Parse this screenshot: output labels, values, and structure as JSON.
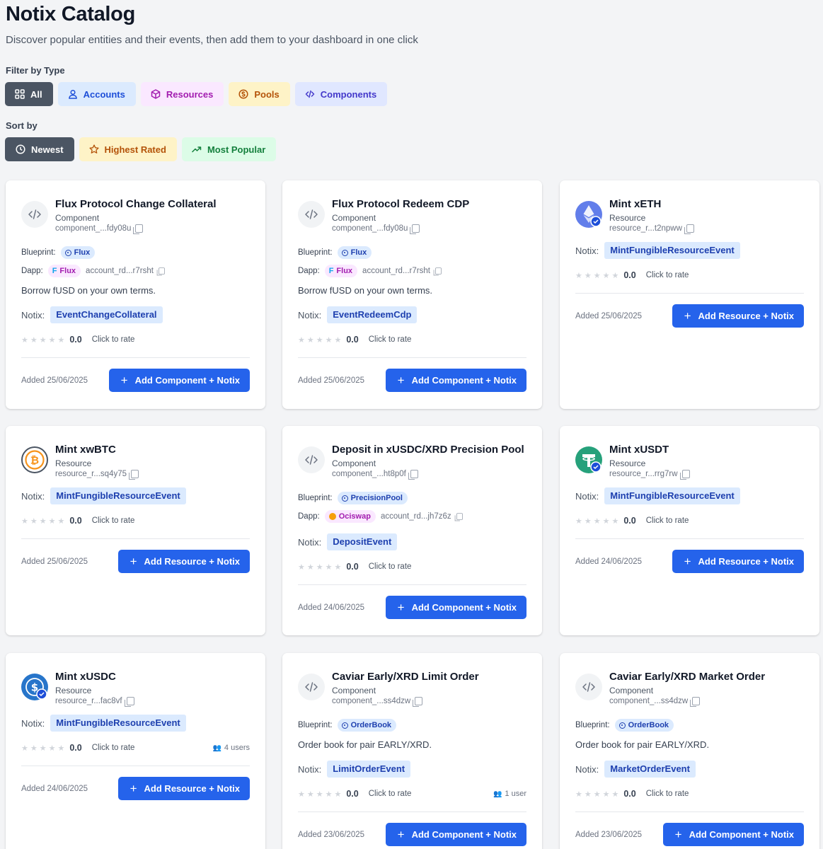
{
  "header": {
    "title": "Notix Catalog",
    "subtitle": "Discover popular entities and their events, then add them to your dashboard in one click"
  },
  "filter": {
    "label": "Filter by Type",
    "options": [
      {
        "label": "All",
        "icon": "grid-icon",
        "selected": true
      },
      {
        "label": "Accounts",
        "icon": "user-icon",
        "selected": false
      },
      {
        "label": "Resources",
        "icon": "box-icon",
        "selected": false
      },
      {
        "label": "Pools",
        "icon": "coin-icon",
        "selected": false
      },
      {
        "label": "Components",
        "icon": "code-icon",
        "selected": false
      }
    ]
  },
  "sort": {
    "label": "Sort by",
    "options": [
      {
        "label": "Newest",
        "icon": "clock-icon",
        "selected": true
      },
      {
        "label": "Highest Rated",
        "icon": "star-icon",
        "selected": false
      },
      {
        "label": "Most Popular",
        "icon": "trending-up-icon",
        "selected": false
      }
    ]
  },
  "common": {
    "blueprint_label": "Blueprint:",
    "dapp_label": "Dapp:",
    "notix_label": "Notix:",
    "click_to_rate": "Click to rate",
    "stars": "★★★★★"
  },
  "cards": [
    {
      "title": "Flux Protocol Change Collateral",
      "type": "Component",
      "address": "component_...fdy08u",
      "icon": "code-icon",
      "blueprint": "Flux",
      "dapp": "Flux",
      "dapp_account": "account_rd...r7rsht",
      "description": "Borrow fUSD on your own terms.",
      "event": "EventChangeCollateral",
      "rating": "0.0",
      "users": "",
      "added": "Added 25/06/2025",
      "button": "Add Component + Notix"
    },
    {
      "title": "Flux Protocol Redeem CDP",
      "type": "Component",
      "address": "component_...fdy08u",
      "icon": "code-icon",
      "blueprint": "Flux",
      "dapp": "Flux",
      "dapp_account": "account_rd...r7rsht",
      "description": "Borrow fUSD on your own terms.",
      "event": "EventRedeemCdp",
      "rating": "0.0",
      "users": "",
      "added": "Added 25/06/2025",
      "button": "Add Component + Notix"
    },
    {
      "title": "Mint xETH",
      "type": "Resource",
      "address": "resource_r...t2npww",
      "icon": "eth-icon",
      "event": "MintFungibleResourceEvent",
      "rating": "0.0",
      "users": "",
      "added": "Added 25/06/2025",
      "button": "Add Resource + Notix"
    },
    {
      "title": "Mint xwBTC",
      "type": "Resource",
      "address": "resource_r...sq4y75",
      "icon": "btc-icon",
      "event": "MintFungibleResourceEvent",
      "rating": "0.0",
      "users": "",
      "added": "Added 25/06/2025",
      "button": "Add Resource + Notix"
    },
    {
      "title": "Deposit in xUSDC/XRD Precision Pool",
      "type": "Component",
      "address": "component_...ht8p0f",
      "icon": "code-icon",
      "blueprint": "PrecisionPool",
      "dapp": "Ociswap",
      "dapp_account": "account_rd...jh7z6z",
      "event": "DepositEvent",
      "rating": "0.0",
      "users": "",
      "added": "Added 24/06/2025",
      "button": "Add Component + Notix"
    },
    {
      "title": "Mint xUSDT",
      "type": "Resource",
      "address": "resource_r...rrg7rw",
      "icon": "usdt-icon",
      "event": "MintFungibleResourceEvent",
      "rating": "0.0",
      "users": "",
      "added": "Added 24/06/2025",
      "button": "Add Resource + Notix"
    },
    {
      "title": "Mint xUSDC",
      "type": "Resource",
      "address": "resource_r...fac8vf",
      "icon": "usdc-icon",
      "event": "MintFungibleResourceEvent",
      "rating": "0.0",
      "users": "4 users",
      "added": "Added 24/06/2025",
      "button": "Add Resource + Notix"
    },
    {
      "title": "Caviar Early/XRD Limit Order",
      "type": "Component",
      "address": "component_...ss4dzw",
      "icon": "code-icon",
      "blueprint": "OrderBook",
      "description": "Order book for pair EARLY/XRD.",
      "event": "LimitOrderEvent",
      "rating": "0.0",
      "users": "1 user",
      "added": "Added 23/06/2025",
      "button": "Add Component + Notix"
    },
    {
      "title": "Caviar Early/XRD Market Order",
      "type": "Component",
      "address": "component_...ss4dzw",
      "icon": "code-icon",
      "blueprint": "OrderBook",
      "description": "Order book for pair EARLY/XRD.",
      "event": "MarketOrderEvent",
      "rating": "0.0",
      "users": "",
      "added": "Added 23/06/2025",
      "button": "Add Component + Notix"
    }
  ],
  "colors": {
    "primary": "#2563eb",
    "selected_chip": "#4b5563",
    "event_bg": "#dbeafe"
  }
}
